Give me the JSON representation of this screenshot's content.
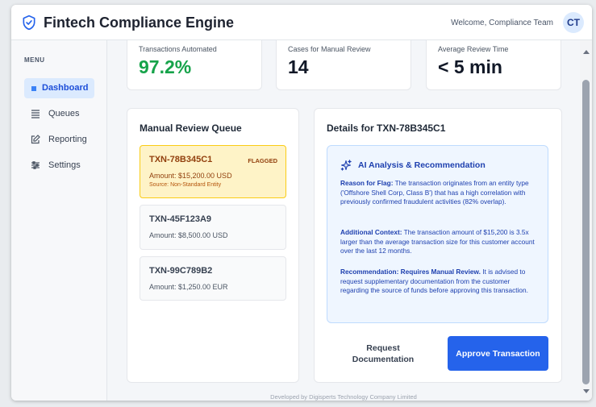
{
  "header": {
    "title": "Fintech Compliance Engine",
    "welcome": "Welcome, Compliance Team",
    "avatar_initials": "CT",
    "logo_icon": "shield-check-icon"
  },
  "sidebar": {
    "menu_label": "MENU",
    "items": [
      {
        "label": "Dashboard",
        "icon": "dashboard-icon",
        "active": true
      },
      {
        "label": "Queues",
        "icon": "list-icon",
        "active": false
      },
      {
        "label": "Reporting",
        "icon": "edit-icon",
        "active": false
      },
      {
        "label": "Settings",
        "icon": "sliders-icon",
        "active": false
      }
    ]
  },
  "stats": [
    {
      "label": "Transactions Automated",
      "value": "97.2%"
    },
    {
      "label": "Cases for Manual Review",
      "value": "14"
    },
    {
      "label": "Average Review Time",
      "value": "< 5 min"
    }
  ],
  "queue": {
    "title": "Manual Review Queue",
    "items": [
      {
        "id": "TXN-78B345C1",
        "badge": "FLAGGED",
        "amount": "Amount: $15,200.00 USD",
        "source": "Source: Non-Standard Entity"
      },
      {
        "id": "TXN-45F123A9",
        "amount": "Amount: $8,500.00 USD"
      },
      {
        "id": "TXN-99C789B2",
        "amount": "Amount: $1,250.00 EUR"
      }
    ]
  },
  "details": {
    "title": "Details for TXN-78B345C1",
    "ai_title": "AI Analysis & Recommendation",
    "reason_label": "Reason for Flag:",
    "reason_text": " The transaction originates from an entity type ('Offshore Shell Corp, Class B') that has a high correlation with previously confirmed fraudulent activities (82% overlap).",
    "context_label": "Additional Context:",
    "context_text": " The transaction amount of $15,200 is 3.5x larger than the average transaction size for this customer account over the last 12 months.",
    "rec_label": "Recommendation: Requires Manual Review.",
    "rec_text": " It is advised to request supplementary documentation from the customer regarding the source of funds before approving this transaction.",
    "request_button": "Request Documentation",
    "approve_button": "Approve Transaction"
  },
  "footer": "Developed by Digisperts Technology Company Limited",
  "colors": {
    "accent": "#2563eb",
    "success": "#16a34a",
    "flag_bg": "#fef3c7",
    "flag_border": "#facc15",
    "ai_bg": "#eff6ff"
  }
}
